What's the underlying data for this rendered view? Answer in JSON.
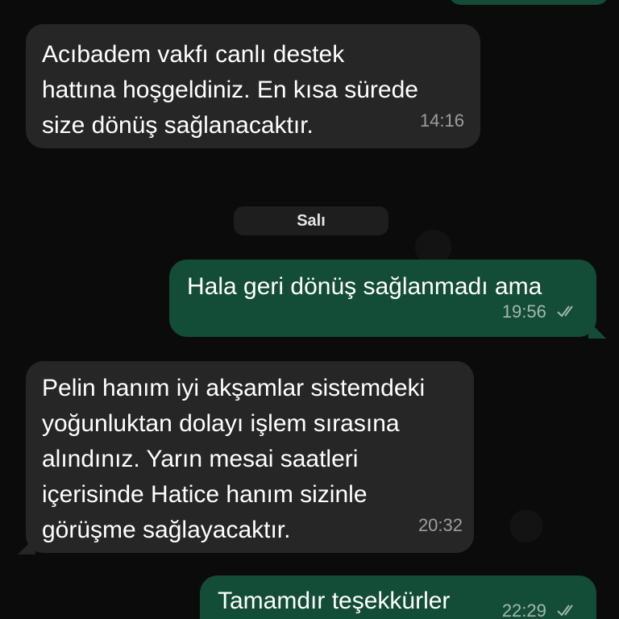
{
  "messages": [
    {
      "direction": "incoming",
      "text": "Acıbadem vakfı canlı destek\nhattına hoşgeldiniz. En kısa sürede\nsize dönüş sağlanacaktır.",
      "time": "14:16"
    },
    {
      "direction": "outgoing",
      "text": "Hala geri dönüş sağlanmadı ama",
      "time": "19:56",
      "status_icon": "double-check-icon"
    },
    {
      "direction": "incoming",
      "text": "Pelin hanım iyi akşamlar sistemdeki\nyoğunluktan dolayı işlem sırasına\nalındınız. Yarın mesai saatleri\niçerisinde Hatice hanım sizinle\ngörüşme sağlayacaktır.",
      "time": "20:32"
    },
    {
      "direction": "outgoing",
      "text": "Tamamdır teşekkürler",
      "time": "22:29",
      "status_icon": "double-check-icon"
    }
  ],
  "date_separator": "Salı",
  "colors": {
    "background": "#0b0b0b",
    "incoming_bubble": "#262626",
    "outgoing_bubble": "#134d37",
    "date_pill": "#1e1e1e"
  }
}
